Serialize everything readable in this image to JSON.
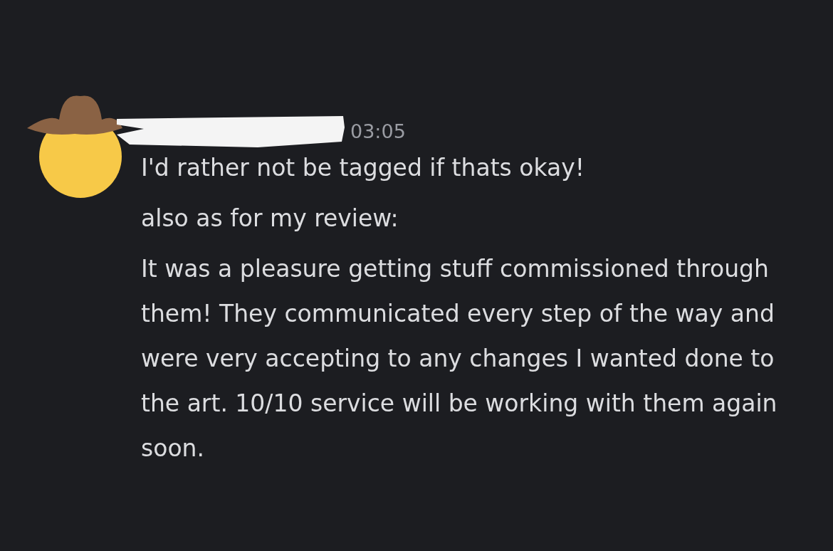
{
  "message": {
    "timestamp": "03:05",
    "username_redacted": true,
    "lines": [
      "I'd rather not be tagged if thats okay!",
      "also as for my review:",
      "It was a pleasure getting stuff commissioned through them! They communicated every step of the way and were very accepting to any changes I wanted done to the art. 10/10 service will be working with them again soon."
    ]
  }
}
